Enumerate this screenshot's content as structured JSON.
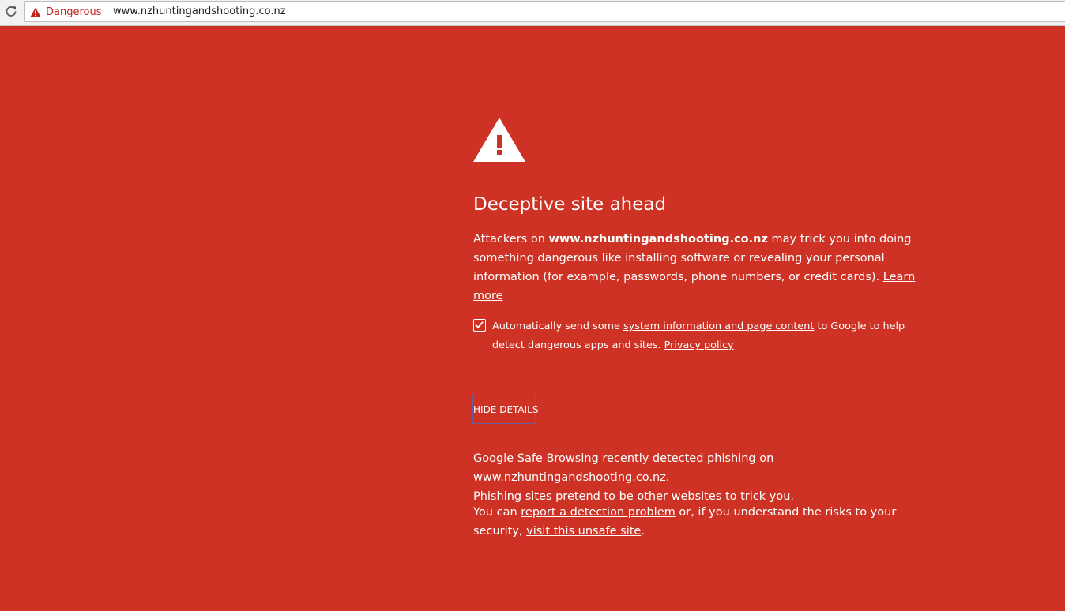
{
  "browser": {
    "security_chip": "Dangerous",
    "url": "www.nzhuntingandshooting.co.nz"
  },
  "interstitial": {
    "heading": "Deceptive site ahead",
    "main": {
      "prefix": "Attackers on ",
      "domain": "www.nzhuntingandshooting.co.nz",
      "suffix": " may trick you into doing something dangerous like installing software or revealing your personal information (for example, passwords, phone numbers, or credit cards). ",
      "learn_more": "Learn more"
    },
    "report": {
      "checked": true,
      "prefix": "Automatically send some ",
      "link": "system information and page content",
      "middle": " to Google to help detect dangerous apps and sites. ",
      "privacy_link": "Privacy policy"
    },
    "details_button": "HIDE DETAILS",
    "details": {
      "line1": "Google Safe Browsing recently detected phishing on www.nzhuntingandshooting.co.nz.",
      "line2": "Phishing sites pretend to be other websites to trick you."
    },
    "final": {
      "prefix": "You can ",
      "report_link": "report a detection problem",
      "middle": " or, if you understand the risks to your security, ",
      "visit_link": "visit this unsafe site",
      "suffix": "."
    }
  },
  "colors": {
    "background": "#cd3224",
    "text": "#ffffff",
    "danger": "#c5221f"
  }
}
